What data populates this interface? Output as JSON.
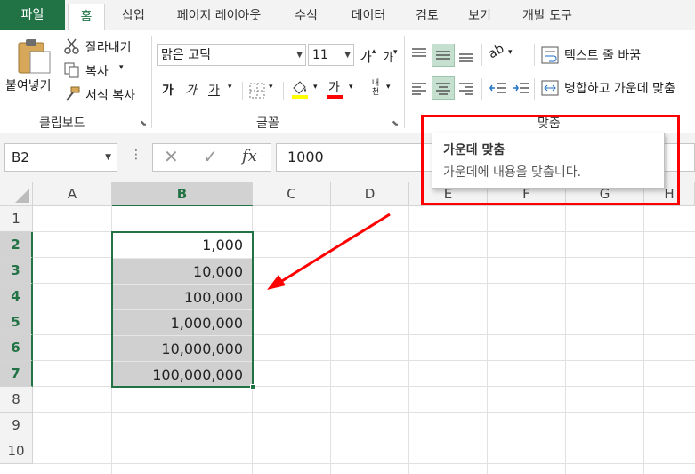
{
  "tabs": [
    {
      "label": "파일"
    },
    {
      "label": "홈"
    },
    {
      "label": "삽입"
    },
    {
      "label": "페이지 레이아웃"
    },
    {
      "label": "수식"
    },
    {
      "label": "데이터"
    },
    {
      "label": "검토"
    },
    {
      "label": "보기"
    },
    {
      "label": "개발 도구"
    }
  ],
  "ribbon": {
    "clipboard": {
      "paste_label": "붙여넣기",
      "cut_label": "잘라내기",
      "copy_label": "복사",
      "format_painter_label": "서식 복사",
      "group_label": "클립보드"
    },
    "font": {
      "font_name": "맑은 고딕",
      "font_size": "11",
      "bold": "가",
      "italic": "가",
      "underline": "가",
      "grow": "가",
      "shrink": "가",
      "font_color_glyph": "가",
      "phonetic": "내천",
      "group_label": "글꼴"
    },
    "alignment": {
      "wrap_text_label": "텍스트 줄 바꿈",
      "merge_center_label": "병합하고 가운데 맞춤",
      "group_label": "맞춤"
    }
  },
  "formula_bar": {
    "name_box": "B2",
    "formula": "1000"
  },
  "columns": [
    "A",
    "B",
    "C",
    "D",
    "E",
    "F",
    "G",
    "H"
  ],
  "rows": [
    "1",
    "2",
    "3",
    "4",
    "5",
    "6",
    "7",
    "8",
    "9",
    "10"
  ],
  "cells": [
    {
      "ref": "B2",
      "value": "1,000"
    },
    {
      "ref": "B3",
      "value": "10,000"
    },
    {
      "ref": "B4",
      "value": "100,000"
    },
    {
      "ref": "B5",
      "value": "1,000,000"
    },
    {
      "ref": "B6",
      "value": "10,000,000"
    },
    {
      "ref": "B7",
      "value": "100,000,000"
    }
  ],
  "tooltip": {
    "title": "가운데 맞춤",
    "description": "가운데에 내용을 맞춥니다."
  },
  "colors": {
    "accent": "#217346",
    "selection_fill": "#d0d0d0",
    "annotation": "#ff0000"
  }
}
